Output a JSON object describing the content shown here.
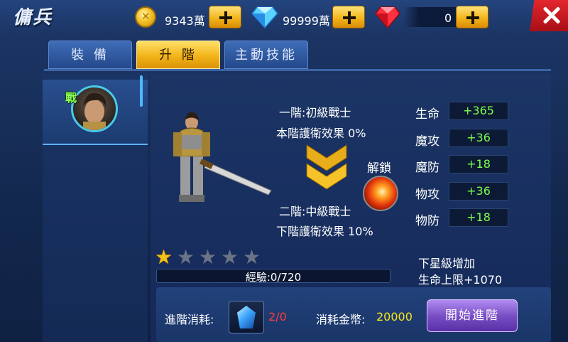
{
  "header": {
    "title": "傭兵",
    "gold": "9343萬",
    "diamonds": "99999萬",
    "rubies": "0"
  },
  "tabs": [
    {
      "label": "裝  備",
      "active": false
    },
    {
      "label": "升  階",
      "active": true
    },
    {
      "label": "主動技能",
      "active": false
    }
  ],
  "unit": {
    "badge": "戰"
  },
  "tier": {
    "current_name": "一階:初級戰士",
    "current_effect": "本階護衛效果 0%",
    "next_name": "二階:中級戰士",
    "next_effect": "下階護衛效果 10%",
    "unlock_label": "解鎖"
  },
  "stats": [
    {
      "label": "生命",
      "value": "+365"
    },
    {
      "label": "魔攻",
      "value": "+36"
    },
    {
      "label": "魔防",
      "value": "+18"
    },
    {
      "label": "物攻",
      "value": "+36"
    },
    {
      "label": "物防",
      "value": "+18"
    }
  ],
  "stars": {
    "filled": 1,
    "total": 5
  },
  "experience": {
    "text": "經驗:0/720",
    "current": 0,
    "max": 720
  },
  "next_star": {
    "title": "下星級增加",
    "bonus": "生命上限+1070"
  },
  "cost": {
    "label": "進階消耗:",
    "item_count": "2/0",
    "gold_label": "消耗金幣:",
    "gold_value": "20000",
    "button_label": "開始進階"
  },
  "colors": {
    "stat_value": "#7bff4b",
    "cost_count": "#ff3b3b",
    "gold_value": "#f7e51b",
    "active_tab": "#f2b419"
  }
}
